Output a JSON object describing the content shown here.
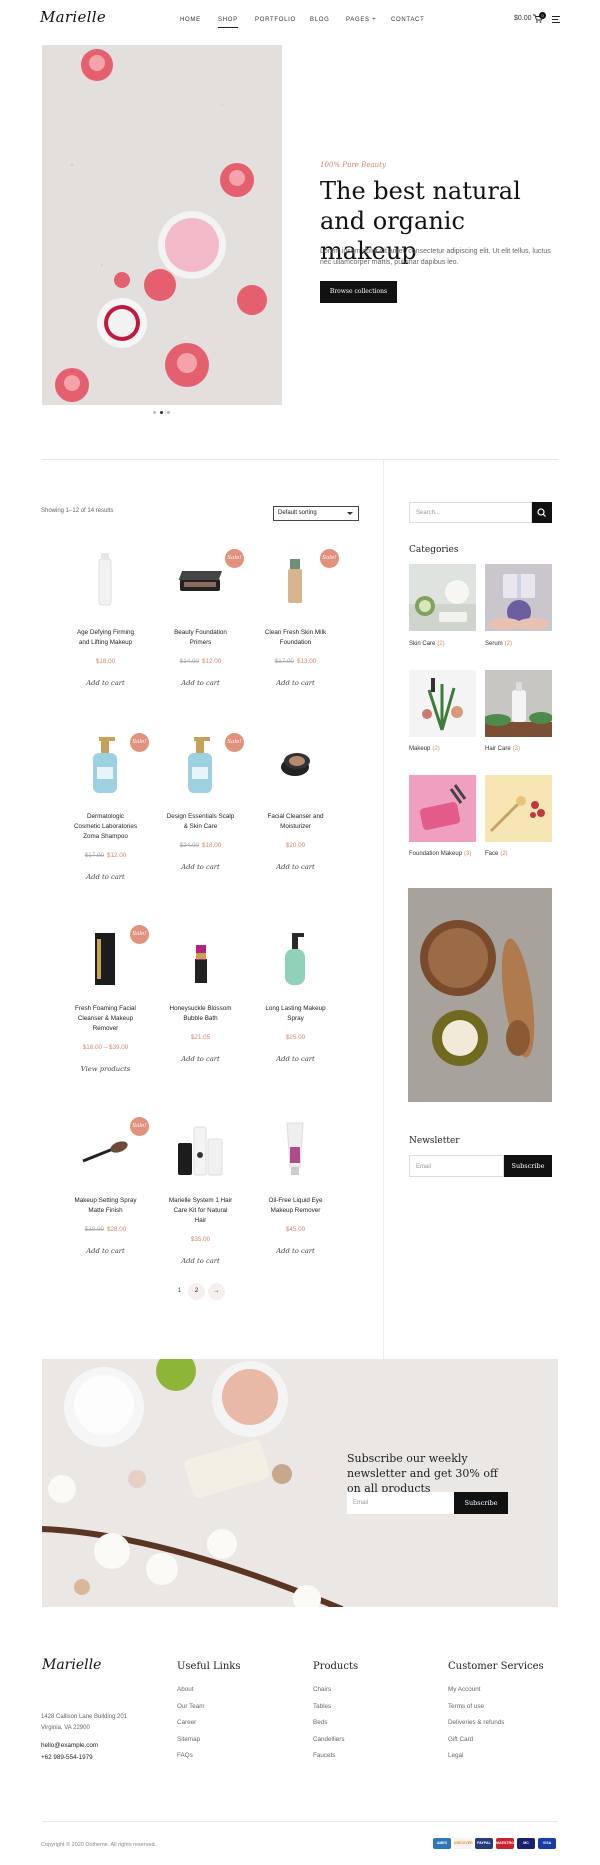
{
  "header": {
    "logo": "Marielle",
    "nav": [
      "HOME",
      "SHOP",
      "PORTFOLIO",
      "BLOG",
      "PAGES +",
      "CONTACT"
    ],
    "cart_total": "$0.00",
    "cart_count": "0"
  },
  "hero": {
    "subtitle": "100% Pure Beauty",
    "title": "The best natural and organic makeup",
    "text": "Lorem ipsum dolor sit amet, consectetur adipiscing elit. Ut elit tellus, luctus nec ullamcorper mattis, pulvinar dapibus leo.",
    "button": "Browse collections"
  },
  "shop": {
    "results_text": "Showing 1–12 of 14 results",
    "sorting_value": "Default sorting",
    "sale_label": "Sale!",
    "products": [
      {
        "name_lines": [
          "Age Defying Firming",
          "and Lifting Makeup"
        ],
        "old_price": "",
        "price": "$18.00",
        "action": "Add to cart",
        "sale": false,
        "icon": "white-bottle-icon"
      },
      {
        "name_lines": [
          "Beauty Foundation",
          "Primers"
        ],
        "old_price": "$14.00",
        "price": "$12.00",
        "action": "Add to cart",
        "sale": true,
        "icon": "eyeshadow-palette-icon"
      },
      {
        "name_lines": [
          "Clean Fresh Skin Milk",
          "Foundation"
        ],
        "old_price": "$17.00",
        "price": "$13.00",
        "action": "Add to cart",
        "sale": true,
        "icon": "foundation-bottle-icon"
      },
      {
        "name_lines": [
          "Dermatologic",
          "Cosmetic Laboratories",
          "Zoma Shampoo"
        ],
        "old_price": "$17.00",
        "price": "$12.00",
        "action": "Add to cart",
        "sale": true,
        "icon": "blue-pump-bottle-icon"
      },
      {
        "name_lines": [
          "Design Essentials Scalp",
          "& Skin Care"
        ],
        "old_price": "$24.00",
        "price": "$18.00",
        "action": "Add to cart",
        "sale": true,
        "icon": "blue-pump-bottle-icon"
      },
      {
        "name_lines": [
          "Facial Cleanser and",
          "Moisturizer"
        ],
        "old_price": "",
        "price": "$20.00",
        "action": "Add to cart",
        "sale": false,
        "icon": "compact-powder-icon"
      },
      {
        "name_lines": [
          "Fresh Foaming Facial",
          "Cleanser & Makeup",
          "Remover"
        ],
        "old_price": "",
        "price": "$18.00 – $39.00",
        "action": "View products",
        "sale": true,
        "icon": "black-box-icon"
      },
      {
        "name_lines": [
          "Honeysuckle Blossom",
          "Bubble Bath"
        ],
        "old_price": "",
        "price": "$21.05",
        "action": "Add to cart",
        "sale": false,
        "icon": "lipstick-icon"
      },
      {
        "name_lines": [
          "Long Lasting Makeup",
          "Spray"
        ],
        "old_price": "",
        "price": "$25.00",
        "action": "Add to cart",
        "sale": false,
        "icon": "green-pump-bottle-icon"
      },
      {
        "name_lines": [
          "Makeup Setting Spray",
          "Matte Finish"
        ],
        "old_price": "$30.00",
        "price": "$28.00",
        "action": "Add to cart",
        "sale": true,
        "icon": "makeup-brush-icon"
      },
      {
        "name_lines": [
          "Marielle System 1 Hair",
          "Care Kit for Natural",
          "Hair"
        ],
        "old_price": "",
        "price": "$35.00",
        "action": "Add to cart",
        "sale": false,
        "icon": "hair-kit-icon"
      },
      {
        "name_lines": [
          "Oil-Free Liquid Eye",
          "Makeup Remover"
        ],
        "old_price": "",
        "price": "$45.00",
        "action": "Add to cart",
        "sale": false,
        "icon": "tube-icon"
      }
    ],
    "pagination": [
      "1",
      "2",
      "→"
    ]
  },
  "sidebar": {
    "search_placeholder": "Search...",
    "categories_title": "Categories",
    "categories": [
      {
        "name": "Skin Care",
        "count": "(2)"
      },
      {
        "name": "Serum",
        "count": "(2)"
      },
      {
        "name": "Makeup",
        "count": "(2)"
      },
      {
        "name": "Hair Care",
        "count": "(3)"
      },
      {
        "name": "Foundation Makeup",
        "count": "(3)"
      },
      {
        "name": "Face",
        "count": "(2)"
      }
    ],
    "newsletter_title": "Newsletter",
    "newsletter_placeholder": "Email",
    "newsletter_button": "Subscribe"
  },
  "subscribe": {
    "title": "Subscribe our weekly newsletter and get 30% off on all products",
    "placeholder": "Email",
    "button": "Subscribe"
  },
  "footer": {
    "logo": "Marielle",
    "address1": "1428 Callison Lane Building 201",
    "address2": "Virginia, VA 22900",
    "email": "hello@example.com",
    "phone": "+62 989-554-1979",
    "columns": [
      {
        "title": "Useful Links",
        "links": [
          "About",
          "Our Team",
          "Career",
          "Sitemap",
          "FAQs"
        ]
      },
      {
        "title": "Products",
        "links": [
          "Chairs",
          "Tables",
          "Beds",
          "Candelliers",
          "Faucets"
        ]
      },
      {
        "title": "Customer Services",
        "links": [
          "My Account",
          "Terms of use",
          "Deliveries & refunds",
          "Gift Card",
          "Legal"
        ]
      }
    ],
    "copyright": "Copyright © 2020 Dotheme. All rights reserved.",
    "payments": [
      "AMEX",
      "DISCOVER",
      "PAYPAL",
      "MAESTRO",
      "MC",
      "VISA"
    ]
  },
  "colors": {
    "accent": "#d4856b",
    "sale": "#e1917c",
    "dark": "#111111"
  }
}
